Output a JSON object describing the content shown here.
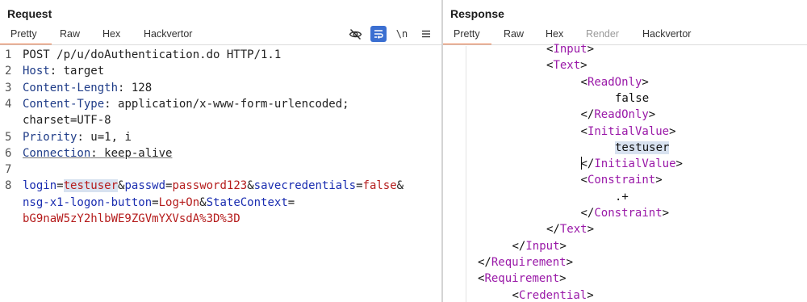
{
  "request": {
    "title": "Request",
    "tabs": [
      "Pretty",
      "Raw",
      "Hex",
      "Hackvertor"
    ],
    "active_tab": "Pretty",
    "toolbar": {
      "hide_icon": "eye-slash-icon",
      "wrap_icon": "wrap-lines-icon",
      "newline_label": "\\n",
      "menu_icon": "hamburger-menu-icon"
    },
    "lines": [
      {
        "n": "1",
        "parts": [
          [
            "plain",
            "POST /p/u/doAuthentication.do HTTP/1.1"
          ]
        ]
      },
      {
        "n": "2",
        "parts": [
          [
            "key",
            "Host"
          ],
          [
            "plain",
            ": target"
          ]
        ]
      },
      {
        "n": "3",
        "parts": [
          [
            "key",
            "Content-Length"
          ],
          [
            "plain",
            ": 128"
          ]
        ]
      },
      {
        "n": "4",
        "parts": [
          [
            "key",
            "Content-Type"
          ],
          [
            "plain",
            ": application/x-www-form-urlencoded;"
          ]
        ]
      },
      {
        "n": "",
        "parts": [
          [
            "plain",
            "charset=UTF-8"
          ]
        ]
      },
      {
        "n": "5",
        "parts": [
          [
            "key",
            "Priority"
          ],
          [
            "plain",
            ": u=1, i"
          ]
        ]
      },
      {
        "n": "6",
        "parts": [
          [
            "key",
            "Connection"
          ],
          [
            "plain",
            ": keep-alive"
          ]
        ]
      },
      {
        "n": "7",
        "parts": []
      },
      {
        "n": "8",
        "parts": [
          [
            "param",
            "login"
          ],
          [
            "plain",
            "="
          ],
          [
            "val-hl",
            "testuser"
          ],
          [
            "plain",
            "&"
          ],
          [
            "param",
            "passwd"
          ],
          [
            "plain",
            "="
          ],
          [
            "val",
            "password123"
          ],
          [
            "plain",
            "&"
          ],
          [
            "param",
            "savecredentials"
          ],
          [
            "plain",
            "="
          ],
          [
            "val",
            "false"
          ],
          [
            "plain",
            "&"
          ]
        ]
      },
      {
        "n": "",
        "parts": [
          [
            "param",
            "nsg-x1-logon-button"
          ],
          [
            "plain",
            "="
          ],
          [
            "val",
            "Log+On"
          ],
          [
            "plain",
            "&"
          ],
          [
            "param",
            "StateContext"
          ],
          [
            "plain",
            "="
          ]
        ]
      },
      {
        "n": "",
        "parts": [
          [
            "val",
            "bG9naW5zY2hlbWE9ZGVmYXVsdA%3D%3D"
          ]
        ]
      }
    ]
  },
  "response": {
    "title": "Response",
    "tabs": [
      "Pretty",
      "Raw",
      "Hex",
      "Render",
      "Hackvertor"
    ],
    "active_tab": "Pretty",
    "lines": [
      {
        "indent": 4,
        "parts": [
          [
            "tag",
            "<Input>"
          ]
        ]
      },
      {
        "indent": 4,
        "parts": [
          [
            "tag",
            "<Text>"
          ]
        ]
      },
      {
        "indent": 5,
        "parts": [
          [
            "tag",
            "<ReadOnly>"
          ]
        ]
      },
      {
        "indent": 6,
        "parts": [
          [
            "plain",
            "false"
          ]
        ]
      },
      {
        "indent": 5,
        "parts": [
          [
            "tag",
            "</ReadOnly>"
          ]
        ]
      },
      {
        "indent": 5,
        "parts": [
          [
            "tag",
            "<InitialValue>"
          ]
        ]
      },
      {
        "indent": 6,
        "parts": [
          [
            "hl",
            "testuser"
          ]
        ]
      },
      {
        "indent": 5,
        "parts": [
          [
            "caret",
            ""
          ],
          [
            "tag",
            "</InitialValue>"
          ]
        ]
      },
      {
        "indent": 5,
        "parts": [
          [
            "tag",
            "<Constraint>"
          ]
        ]
      },
      {
        "indent": 6,
        "parts": [
          [
            "plain",
            ".+"
          ]
        ]
      },
      {
        "indent": 5,
        "parts": [
          [
            "tag",
            "</Constraint>"
          ]
        ]
      },
      {
        "indent": 4,
        "parts": [
          [
            "tag",
            "</Text>"
          ]
        ]
      },
      {
        "indent": 3,
        "parts": [
          [
            "tag",
            "</Input>"
          ]
        ]
      },
      {
        "indent": 2,
        "parts": [
          [
            "tag",
            "</Requirement>"
          ]
        ]
      },
      {
        "indent": 2,
        "parts": [
          [
            "tag",
            "<Requirement>"
          ]
        ]
      },
      {
        "indent": 3,
        "parts": [
          [
            "tag",
            "<Credential>"
          ]
        ]
      }
    ]
  }
}
